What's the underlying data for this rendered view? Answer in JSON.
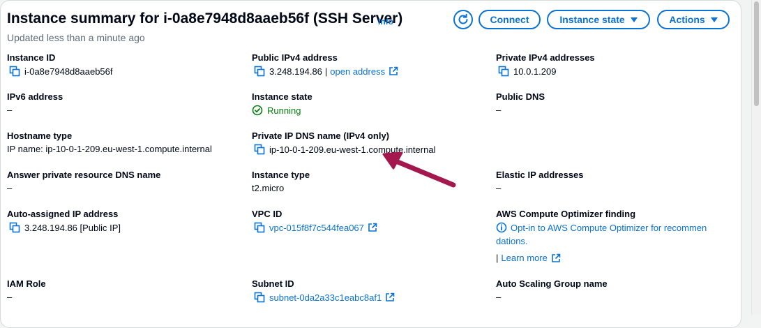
{
  "header": {
    "title": "Instance summary for i-0a8e7948d8aaeb56f (SSH Server)",
    "info": "Info",
    "updated": "Updated less than a minute ago",
    "connect": "Connect",
    "instance_state_btn": "Instance state",
    "actions": "Actions"
  },
  "col1": {
    "instance_id_label": "Instance ID",
    "instance_id": "i-0a8e7948d8aaeb56f",
    "ipv6_label": "IPv6 address",
    "ipv6": "–",
    "hostname_type_label": "Hostname type",
    "hostname_type": "IP name: ip-10-0-1-209.eu-west-1.compute.internal",
    "answer_dns_label": "Answer private resource DNS name",
    "answer_dns": "–",
    "auto_ip_label": "Auto-assigned IP address",
    "auto_ip": "3.248.194.86 [Public IP]",
    "iam_label": "IAM Role",
    "iam": "–"
  },
  "col2": {
    "public_ipv4_label": "Public IPv4 address",
    "public_ipv4": "3.248.194.86",
    "public_ipv4_sep": "|",
    "open_address": "open address",
    "state_label": "Instance state",
    "state": "Running",
    "private_dns_label": "Private IP DNS name (IPv4 only)",
    "private_dns": "ip-10-0-1-209.eu-west-1.compute.internal",
    "type_label": "Instance type",
    "type": "t2.micro",
    "vpc_label": "VPC ID",
    "vpc": "vpc-015f8f7c544fea067",
    "subnet_label": "Subnet ID",
    "subnet": "subnet-0da2a33c1eabc8af1"
  },
  "col3": {
    "private_ipv4_label": "Private IPv4 addresses",
    "private_ipv4": "10.0.1.209",
    "public_dns_label": "Public DNS",
    "public_dns": "–",
    "elastic_label": "Elastic IP addresses",
    "elastic": "–",
    "optimizer_label": "AWS Compute Optimizer finding",
    "optimizer_line1": "Opt-in to AWS Compute Optimizer for recommen",
    "optimizer_line2": "dations.",
    "learn_sep": "|",
    "learn_more": "Learn more",
    "asg_label": "Auto Scaling Group name",
    "asg": "–"
  },
  "colors": {
    "link": "#0972d3",
    "success": "#037f0c",
    "annotation_arrow": "#a3184e"
  }
}
